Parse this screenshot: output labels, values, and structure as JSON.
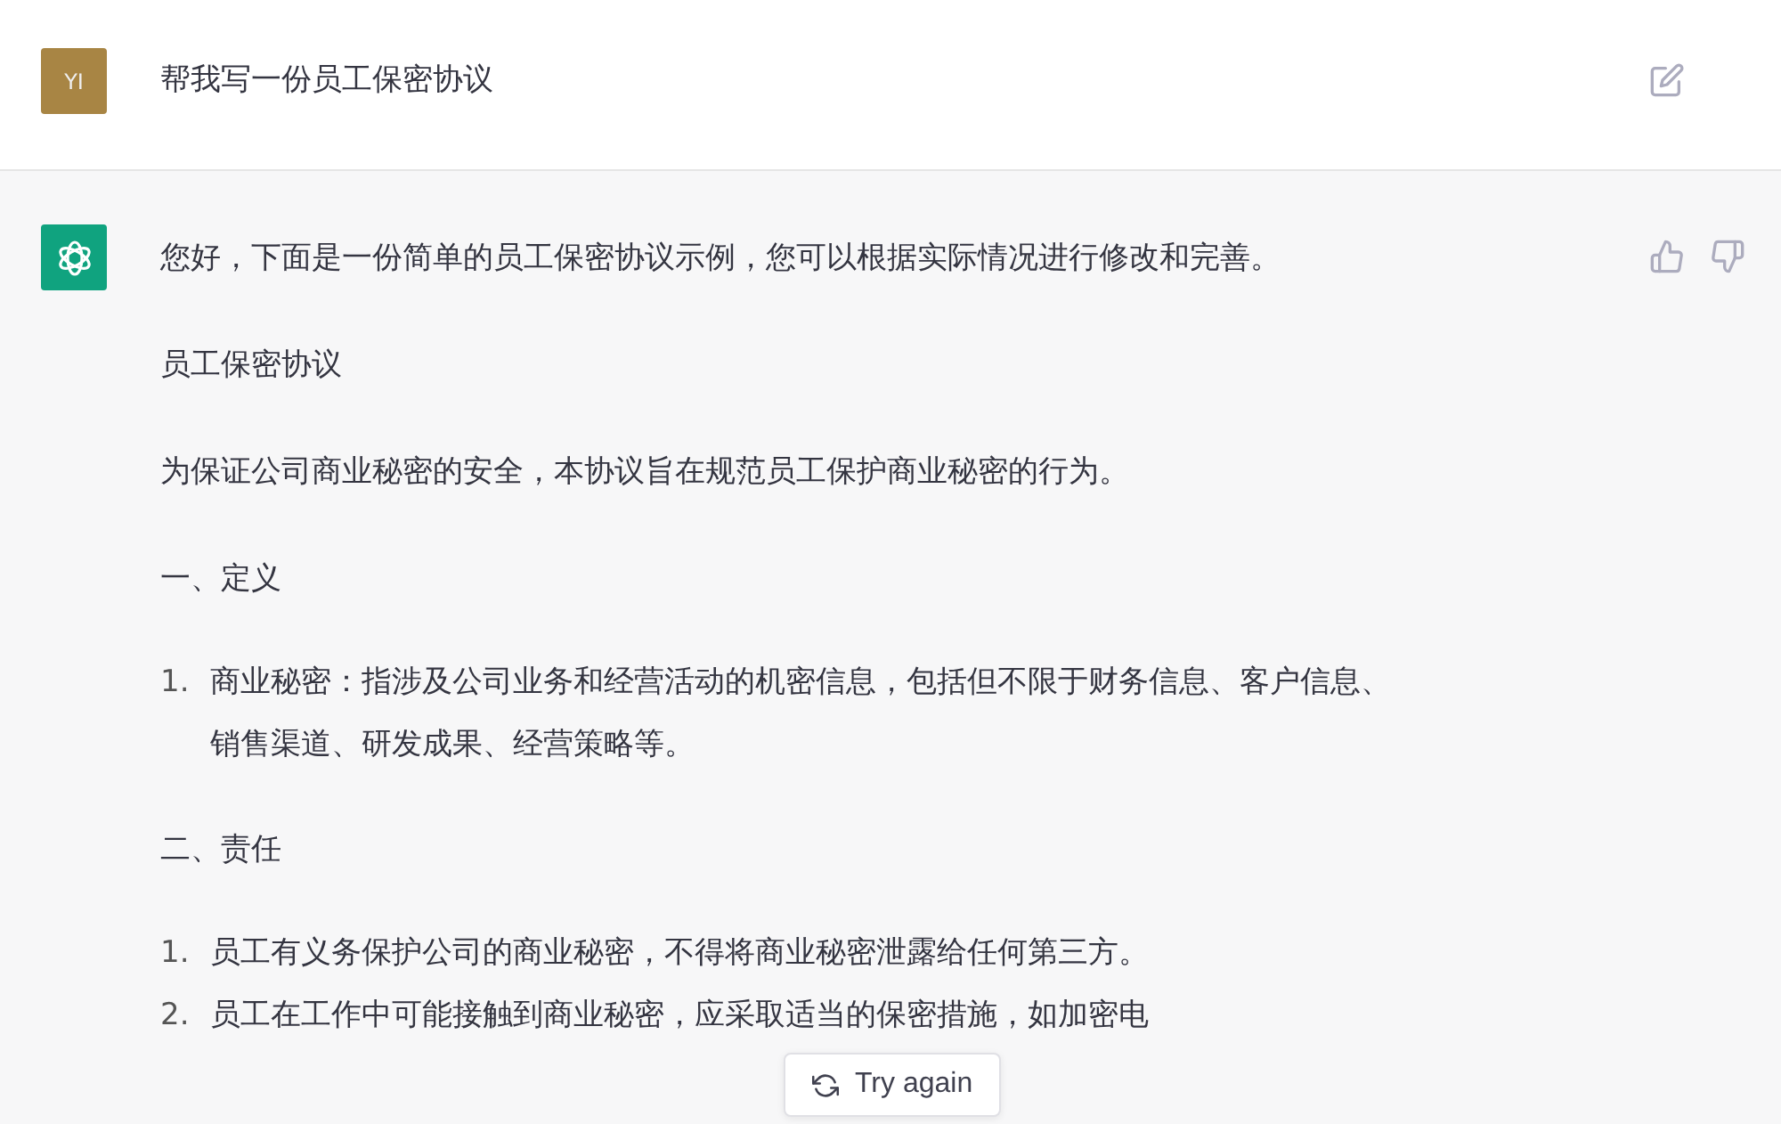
{
  "user_message": {
    "avatar": "YI",
    "text": "帮我写一份员工保密协议"
  },
  "assistant_message": {
    "blocks": [
      {
        "kind": "paragraph",
        "text": "您好，下面是一份简单的员工保密协议示例，您可以根据实际情况进行修改和完善。"
      },
      {
        "kind": "paragraph",
        "text": "员工保密协议"
      },
      {
        "kind": "paragraph",
        "text": "为保证公司商业秘密的安全，本协议旨在规范员工保护商业秘密的行为。"
      },
      {
        "kind": "paragraph",
        "text": "一、定义"
      },
      {
        "kind": "list",
        "items": [
          {
            "number": "1.",
            "text": "商业秘密：指涉及公司业务和经营活动的机密信息，包括但不限于财务信息、客户信息、销售渠道、研发成果、经营策略等。"
          }
        ]
      },
      {
        "kind": "paragraph",
        "text": "二、责任"
      },
      {
        "kind": "list",
        "items": [
          {
            "number": "1.",
            "text": "员工有义务保护公司的商业秘密，不得将商业秘密泄露给任何第三方。"
          },
          {
            "number": "2.",
            "text": "员工在工作中可能接触到商业秘密，应采取适当的保密措施，如加密电"
          }
        ]
      }
    ]
  },
  "try_again_button": {
    "label": "Try again"
  }
}
